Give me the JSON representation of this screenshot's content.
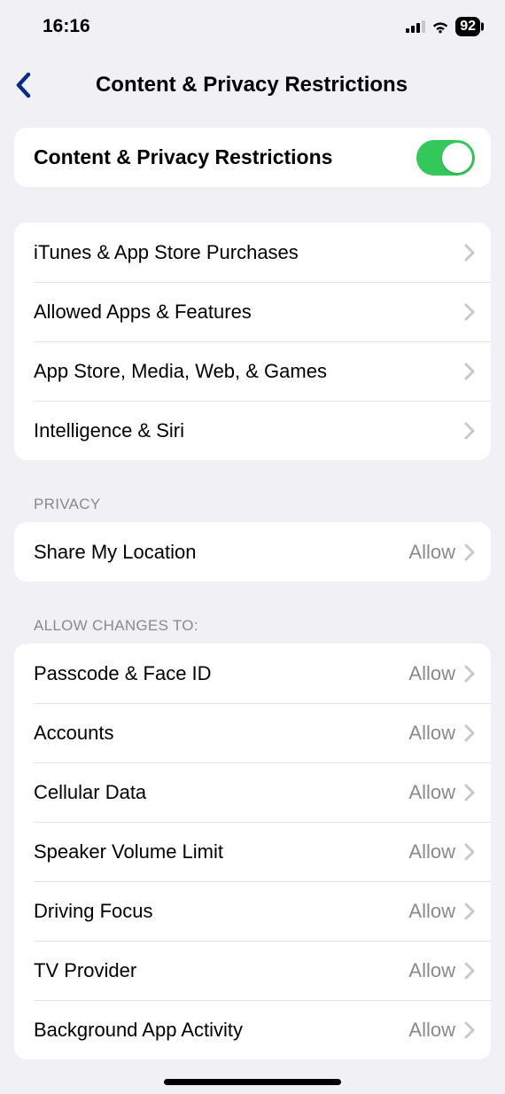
{
  "status": {
    "time": "16:16",
    "battery": "92"
  },
  "header": {
    "title": "Content & Privacy Restrictions"
  },
  "toggle_row": {
    "label": "Content & Privacy Restrictions",
    "on": true
  },
  "group_main": {
    "items": [
      {
        "label": "iTunes & App Store Purchases"
      },
      {
        "label": "Allowed Apps & Features"
      },
      {
        "label": "App Store, Media, Web, & Games"
      },
      {
        "label": "Intelligence & Siri"
      }
    ]
  },
  "group_privacy": {
    "header": "Privacy",
    "items": [
      {
        "label": "Share My Location",
        "value": "Allow"
      }
    ]
  },
  "group_changes": {
    "header": "Allow changes to:",
    "items": [
      {
        "label": "Passcode & Face ID",
        "value": "Allow"
      },
      {
        "label": "Accounts",
        "value": "Allow"
      },
      {
        "label": "Cellular Data",
        "value": "Allow"
      },
      {
        "label": "Speaker Volume Limit",
        "value": "Allow"
      },
      {
        "label": "Driving Focus",
        "value": "Allow"
      },
      {
        "label": "TV Provider",
        "value": "Allow"
      },
      {
        "label": "Background App Activity",
        "value": "Allow"
      }
    ]
  }
}
